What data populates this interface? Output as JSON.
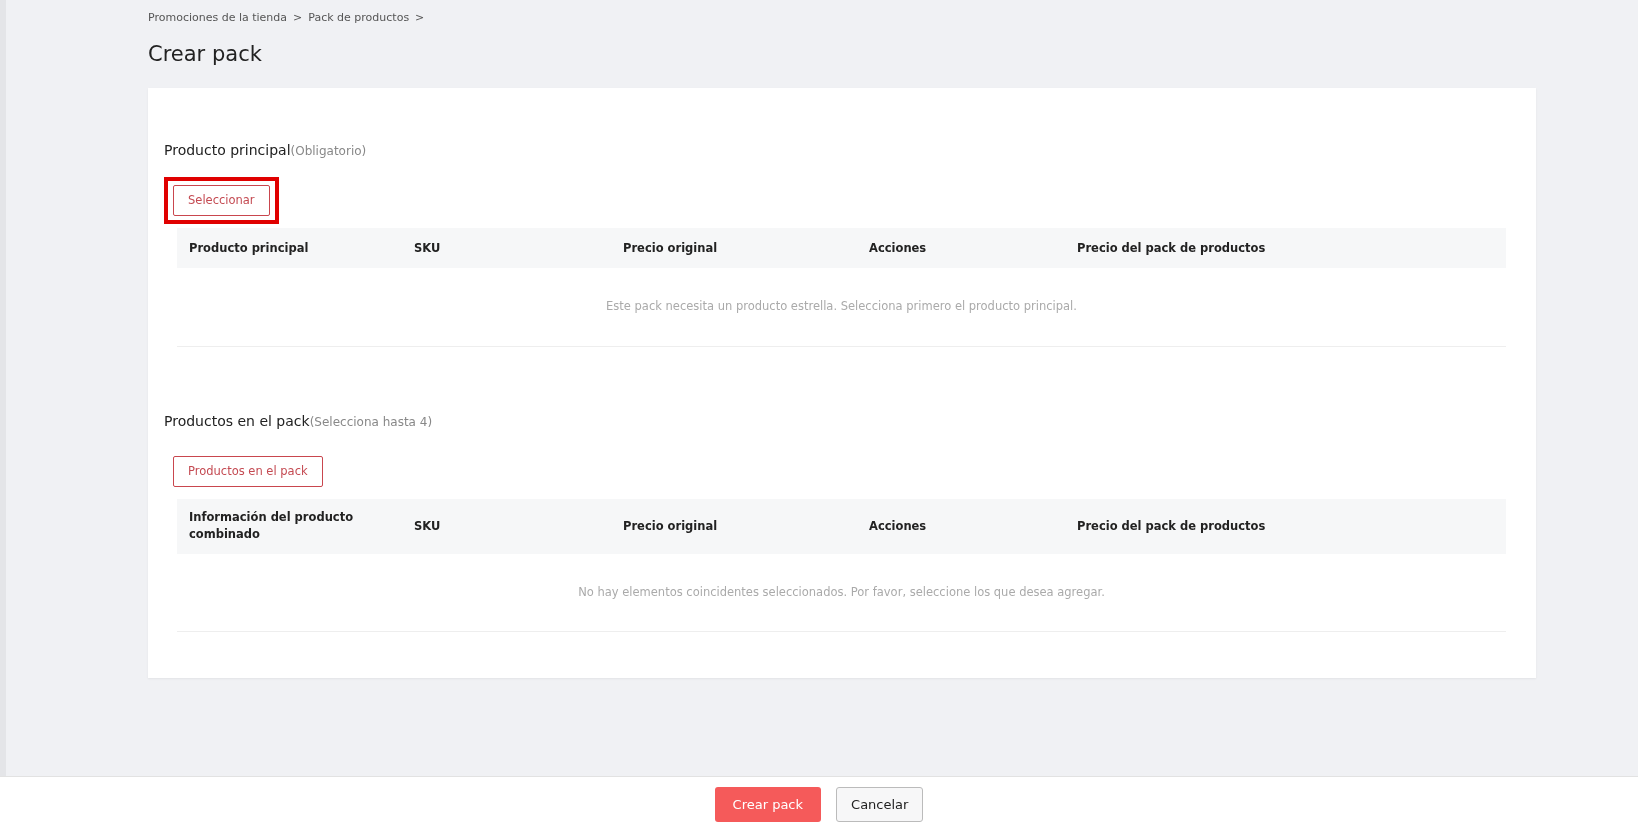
{
  "breadcrumb": [
    {
      "label": "Promociones de la tienda",
      "separator": ">"
    },
    {
      "label": "Pack de productos",
      "separator": ">"
    }
  ],
  "title": "Crear pack",
  "sections": [
    {
      "heading": "Producto principal",
      "hint": "(Obligatorio)",
      "button": {
        "label": "Seleccionar",
        "highlighted": true
      },
      "columns": [
        "Producto principal",
        "SKU",
        "Precio original",
        "Acciones",
        "Precio del pack de productos"
      ],
      "empty_message": "Este pack necesita un producto estrella. Selecciona primero el producto principal."
    },
    {
      "heading": "Productos en el pack",
      "hint": "(Selecciona hasta 4)",
      "button": {
        "label": "Productos en el pack",
        "highlighted": false
      },
      "columns": [
        "Información del producto combinado",
        "SKU",
        "Precio original",
        "Acciones",
        "Precio del pack de productos"
      ],
      "empty_message": "No hay elementos coincidentes seleccionados. Por favor, seleccione los que desea agregar."
    }
  ],
  "footer": {
    "buttons": [
      {
        "label": "Crear pack",
        "kind": "primary"
      },
      {
        "label": "Cancelar",
        "kind": "secondary"
      }
    ]
  }
}
